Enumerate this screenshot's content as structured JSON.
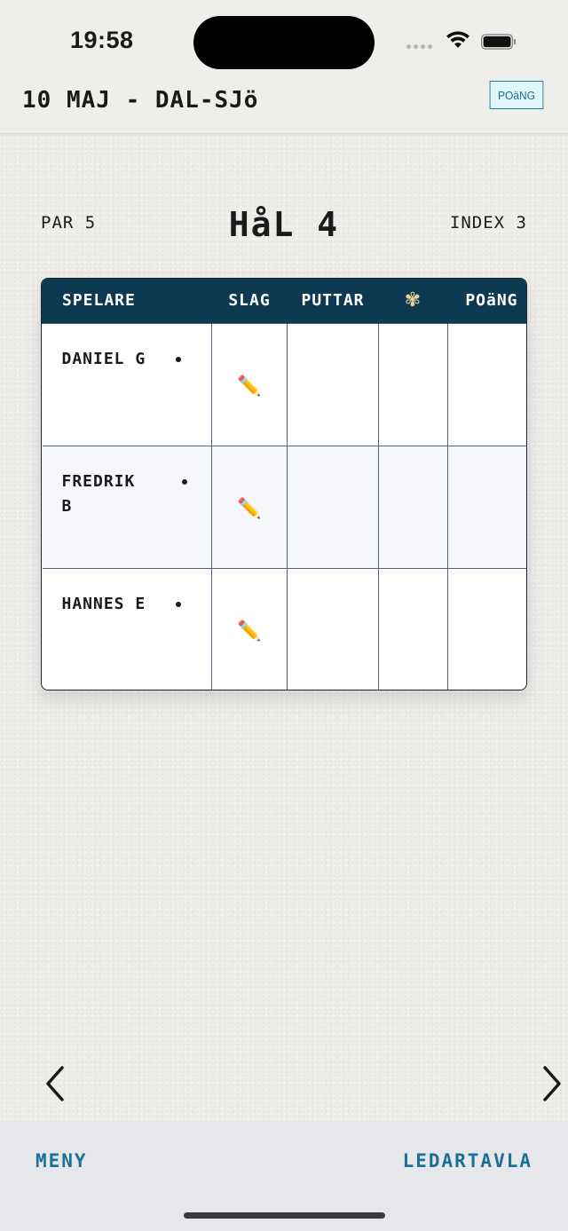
{
  "status_bar": {
    "time": "19:58"
  },
  "header": {
    "title": "10 MAJ - DAL-SJö",
    "points_button": "POäNG"
  },
  "hole": {
    "par": "PAR 5",
    "title": "HåL 4",
    "index": "INDEX 3"
  },
  "table": {
    "headers": {
      "player": "SPELARE",
      "strokes": "SLAG",
      "putts": "PUTTAR",
      "special_icon": "flower-icon",
      "points": "POäNG"
    },
    "rows": [
      {
        "name": "DANIEL G",
        "strokes_icon": "pencil-icon"
      },
      {
        "name": "FREDRIK B",
        "strokes_icon": "pencil-icon"
      },
      {
        "name": "HANNES E",
        "strokes_icon": "pencil-icon"
      }
    ]
  },
  "bottom_bar": {
    "menu": "MENY",
    "leaderboard": "LEDARTAVLA"
  },
  "colors": {
    "table_header_bg": "#0d3a52",
    "accent": "#1c6f96",
    "points_button_bg": "#dff6fb"
  }
}
